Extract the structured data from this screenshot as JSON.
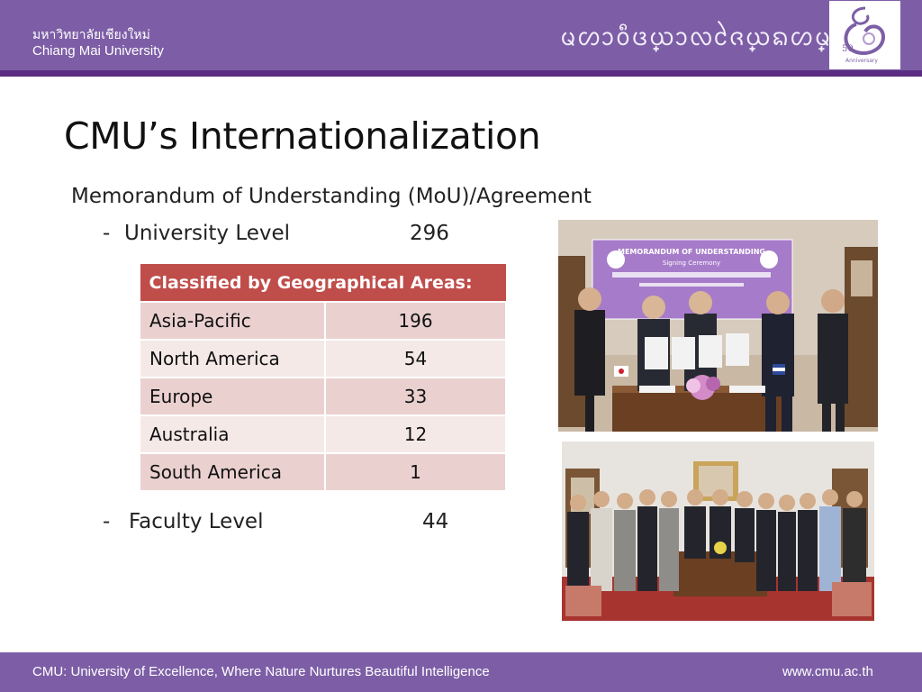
{
  "header": {
    "thai_name": "มหาวิทยาลัยเชียงใหม่",
    "english_name": "Chiang Mai University",
    "lanna_script": "ᨾᩉᩣᩅᩥᨴ᩠ᨿᩣᩃᩱᨩ᩠ᨿᨦᩉ᩠ᨾᩲ᩵",
    "logo_text": "50th Anniversary",
    "accent_color": "#7d5ea6",
    "stripe_color": "#5a2e82"
  },
  "slide": {
    "title": "CMU’s Internationalization",
    "subtitle": "Memorandum of Understanding (MoU)/Agreement",
    "university_level": {
      "dash": "-",
      "label": "University Level",
      "value": "296"
    },
    "faculty_level": {
      "dash": "-",
      "label": "Faculty Level",
      "value": "44"
    }
  },
  "table": {
    "header": "Classified by Geographical Areas:",
    "header_color": "#bf4d4a",
    "rows": [
      {
        "area": "Asia-Pacific",
        "count": "196"
      },
      {
        "area": "North America",
        "count": "54"
      },
      {
        "area": "Europe",
        "count": "33"
      },
      {
        "area": "Australia",
        "count": "12"
      },
      {
        "area": "South America",
        "count": "1"
      }
    ]
  },
  "photos": {
    "banner_title": "MEMORANDUM OF UNDERSTANDING",
    "banner_subtitle": "Signing Ceremony"
  },
  "footer": {
    "tagline": "CMU: University of Excellence, Where Nature Nurtures Beautiful Intelligence",
    "url": "www.cmu.ac.th"
  }
}
